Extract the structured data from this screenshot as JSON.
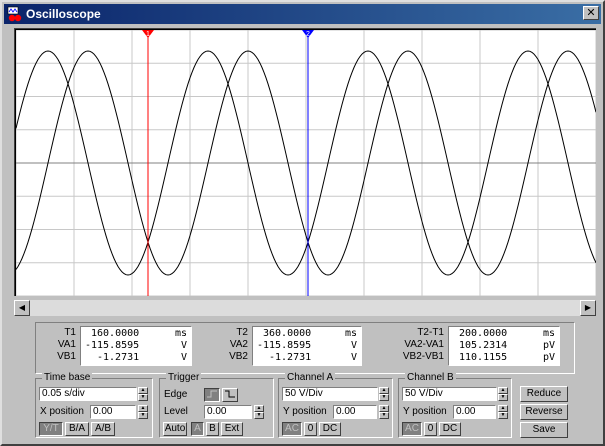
{
  "window": {
    "title": "Oscilloscope",
    "close_label": "✕"
  },
  "cursors": {
    "t1_label": "1",
    "t2_label": "2"
  },
  "readout": {
    "t1": {
      "label": "T1",
      "value": "160.0000",
      "unit": "ms"
    },
    "va1": {
      "label": "VA1",
      "value": "-115.8595",
      "unit": "V"
    },
    "vb1": {
      "label": "VB1",
      "value": "-1.2731",
      "unit": "V"
    },
    "t2": {
      "label": "T2",
      "value": "360.0000",
      "unit": "ms"
    },
    "va2": {
      "label": "VA2",
      "value": "-115.8595",
      "unit": "V"
    },
    "vb2": {
      "label": "VB2",
      "value": "-1.2731",
      "unit": "V"
    },
    "dt": {
      "label": "T2-T1",
      "value": "200.0000",
      "unit": "ms"
    },
    "dva": {
      "label": "VA2-VA1",
      "value": "105.2314",
      "unit": "pV"
    },
    "dvb": {
      "label": "VB2-VB1",
      "value": "110.1155",
      "unit": "pV"
    }
  },
  "timebase": {
    "title": "Time base",
    "scale": "0.05 s/div",
    "xpos_label": "X position",
    "xpos_value": "0.00",
    "modes": [
      "Y/T",
      "B/A",
      "A/B"
    ]
  },
  "trigger": {
    "title": "Trigger",
    "edge_label": "Edge",
    "level_label": "Level",
    "level_value": "0.00",
    "modes": [
      "Auto",
      "A",
      "B",
      "Ext"
    ]
  },
  "channel_a": {
    "title": "Channel A",
    "scale": "50 V/Div",
    "ypos_label": "Y position",
    "ypos_value": "0.00",
    "coupling": [
      "AC",
      "0",
      "DC"
    ]
  },
  "channel_b": {
    "title": "Channel B",
    "scale": "50 V/Div",
    "ypos_label": "Y position",
    "ypos_value": "0.00",
    "coupling": [
      "AC",
      "0",
      "DC"
    ]
  },
  "buttons": {
    "reduce": "Reduce",
    "reverse": "Reverse",
    "save": "Save"
  },
  "colors": {
    "cursor1": "#ff0000",
    "cursor2": "#0000ff",
    "trace": "#000000",
    "grid": "#c8c8c8"
  }
}
